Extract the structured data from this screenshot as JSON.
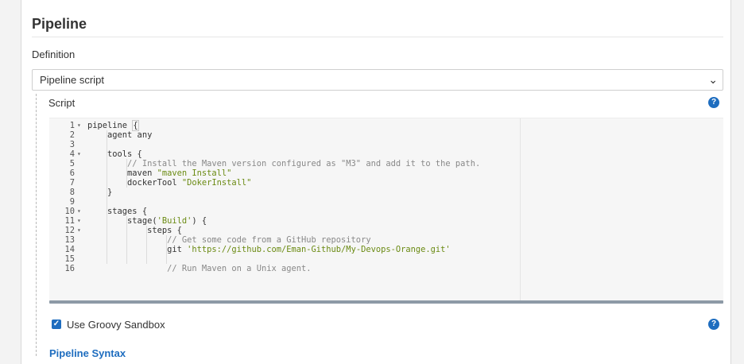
{
  "pipeline": {
    "title": "Pipeline",
    "definition_label": "Definition",
    "definition_value": "Pipeline script",
    "script_label": "Script",
    "help_glyph": "?",
    "sandbox_label": "Use Groovy Sandbox",
    "sandbox_checked": true,
    "syntax_link": "Pipeline Syntax"
  },
  "editor": {
    "lines": [
      {
        "n": "1",
        "fold": true,
        "code": [
          [
            "",
            "pipeline "
          ],
          [
            "brace",
            "{"
          ]
        ]
      },
      {
        "n": "2",
        "fold": false,
        "code": [
          [
            "",
            "    agent any"
          ]
        ]
      },
      {
        "n": "3",
        "fold": false,
        "code": []
      },
      {
        "n": "4",
        "fold": true,
        "code": [
          [
            "",
            "    tools {"
          ]
        ]
      },
      {
        "n": "5",
        "fold": false,
        "code": [
          [
            "cmt",
            "        // Install the Maven version configured as \"M3\" and add it to the path."
          ]
        ]
      },
      {
        "n": "6",
        "fold": false,
        "code": [
          [
            "",
            "        maven "
          ],
          [
            "str",
            "\"maven Install\""
          ]
        ]
      },
      {
        "n": "7",
        "fold": false,
        "code": [
          [
            "",
            "        dockerTool "
          ],
          [
            "str",
            "\"DokerInstall\""
          ]
        ]
      },
      {
        "n": "8",
        "fold": false,
        "code": [
          [
            "",
            "    }"
          ]
        ]
      },
      {
        "n": "9",
        "fold": false,
        "code": []
      },
      {
        "n": "10",
        "fold": true,
        "code": [
          [
            "",
            "    stages {"
          ]
        ]
      },
      {
        "n": "11",
        "fold": true,
        "code": [
          [
            "",
            "        stage("
          ],
          [
            "str",
            "'Build'"
          ],
          [
            "",
            ") {"
          ]
        ]
      },
      {
        "n": "12",
        "fold": true,
        "code": [
          [
            "",
            "            steps {"
          ]
        ]
      },
      {
        "n": "13",
        "fold": false,
        "code": [
          [
            "cmt",
            "                // Get some code from a GitHub repository"
          ]
        ]
      },
      {
        "n": "14",
        "fold": false,
        "code": [
          [
            "",
            "                git "
          ],
          [
            "str",
            "'https://github.com/Eman-Github/My-Devops-Orange.git'"
          ]
        ]
      },
      {
        "n": "15",
        "fold": false,
        "code": []
      },
      {
        "n": "16",
        "fold": false,
        "code": [
          [
            "cmt",
            "                // Run Maven on a Unix agent."
          ]
        ]
      }
    ]
  }
}
